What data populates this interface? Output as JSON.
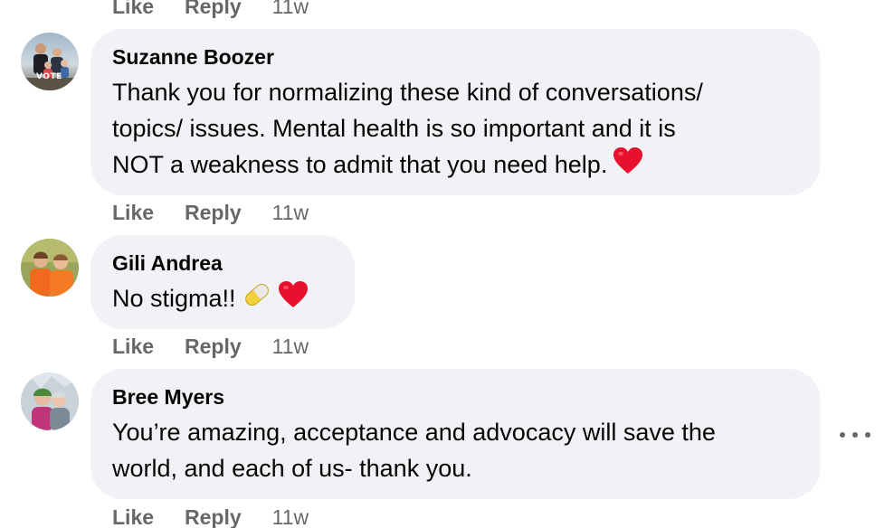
{
  "top_actions": {
    "like": "Like",
    "reply": "Reply",
    "time": "11w"
  },
  "comments": [
    {
      "author": "Suzanne Boozer",
      "avatar_badge": "VOTE",
      "lines": [
        "Thank you for normalizing these kind of conversations/",
        "topics/ issues. Mental health is so important and it is",
        "NOT a weakness to admit that you need help."
      ],
      "emojis": [
        "heart-icon"
      ],
      "actions": {
        "like": "Like",
        "reply": "Reply",
        "time": "11w"
      }
    },
    {
      "author": "Gili Andrea",
      "lines": [
        "No stigma!!"
      ],
      "emojis": [
        "pill-icon",
        "heart-icon"
      ],
      "actions": {
        "like": "Like",
        "reply": "Reply",
        "time": "11w"
      }
    },
    {
      "author": "Bree Myers",
      "lines": [
        "You’re amazing, acceptance and advocacy will save the",
        "world, and each of us- thank you."
      ],
      "emojis": [],
      "actions": {
        "like": "Like",
        "reply": "Reply",
        "time": "11w"
      }
    }
  ],
  "colors": {
    "bubble_bg": "#f0f2f5",
    "secondary_text": "#65676b",
    "heart": "#e8112d"
  },
  "icons": {
    "more": "more-options-icon"
  }
}
